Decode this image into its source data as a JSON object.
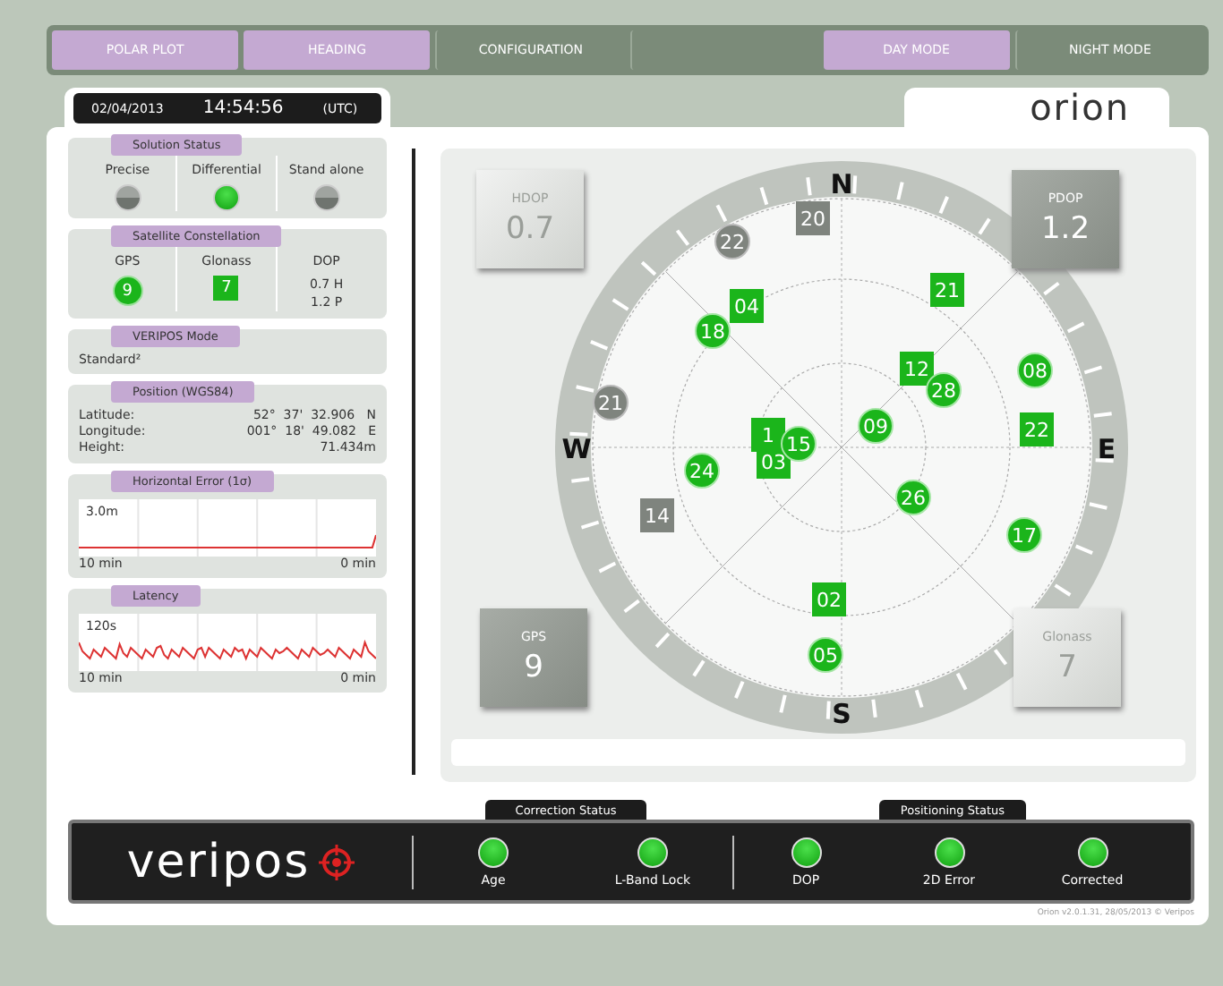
{
  "nav_tabs": [
    {
      "label": "POLAR PLOT",
      "selected": true
    },
    {
      "label": "HEADING",
      "selected": true
    },
    {
      "label": "CONFIGURATION",
      "selected": false
    },
    {
      "selected": false
    },
    {
      "label": "DAY MODE",
      "selected": true
    },
    {
      "label": "NIGHT MODE",
      "selected": false
    }
  ],
  "clock": {
    "date": "02/04/2013",
    "time": "14:54:56",
    "zone": "(UTC)"
  },
  "logo": "orion",
  "solution_status": {
    "title": "Solution Status",
    "items": [
      {
        "label": "Precise",
        "on": false
      },
      {
        "label": "Differential",
        "on": true
      },
      {
        "label": "Stand alone",
        "on": false
      }
    ]
  },
  "satellite_constellation": {
    "title": "Satellite Constellation",
    "gps": {
      "label": "GPS",
      "count": "9"
    },
    "glonass": {
      "label": "Glonass",
      "count": "7"
    },
    "dop": {
      "label": "DOP",
      "lines": [
        "0.7 H",
        "1.2 P"
      ]
    }
  },
  "veripos_mode": {
    "title": "VERIPOS Mode",
    "value": "Standard²"
  },
  "position": {
    "title": "Position  (WGS84)",
    "rows": [
      {
        "label": "Latitude:",
        "value": "52°  37'  32.906   N"
      },
      {
        "label": "Longitude:",
        "value": "001°  18'  49.082   E"
      },
      {
        "label": "Height:",
        "value": "71.434m"
      }
    ]
  },
  "horizontal_error": {
    "title": "Horizontal Error (1σ)",
    "scale": "3.0m",
    "left": "10 min",
    "right": "0 min"
  },
  "latency": {
    "title": "Latency",
    "scale": "120s",
    "left": "10 min",
    "right": "0 min"
  },
  "polar_plot": {
    "compass": [
      "N",
      "E",
      "S",
      "W"
    ],
    "corners": [
      {
        "label": "HDOP",
        "value": "0.7"
      },
      {
        "label": "PDOP",
        "value": "1.2"
      },
      {
        "label": "GPS",
        "value": "9"
      },
      {
        "label": "Glonass",
        "value": "7"
      }
    ],
    "satellites": [
      {
        "id": "22",
        "kind": "gps",
        "used": false
      },
      {
        "id": "20",
        "kind": "glonass",
        "used": false
      },
      {
        "id": "18",
        "kind": "gps",
        "used": true
      },
      {
        "id": "04",
        "kind": "glonass",
        "used": true
      },
      {
        "id": "21",
        "kind": "glonass",
        "used": true
      },
      {
        "id": "21",
        "kind": "gps",
        "used": false
      },
      {
        "id": "12",
        "kind": "glonass",
        "used": true
      },
      {
        "id": "28",
        "kind": "gps",
        "used": true
      },
      {
        "id": "08",
        "kind": "gps",
        "used": true
      },
      {
        "id": "24",
        "kind": "gps",
        "used": true
      },
      {
        "id": "1",
        "kind": "glonass",
        "used": true
      },
      {
        "id": "03",
        "kind": "glonass",
        "used": true
      },
      {
        "id": "15",
        "kind": "gps",
        "used": true
      },
      {
        "id": "09",
        "kind": "gps",
        "used": true
      },
      {
        "id": "22",
        "kind": "glonass",
        "used": true
      },
      {
        "id": "14",
        "kind": "glonass",
        "used": false
      },
      {
        "id": "26",
        "kind": "gps",
        "used": true
      },
      {
        "id": "17",
        "kind": "gps",
        "used": true
      },
      {
        "id": "02",
        "kind": "glonass",
        "used": true
      },
      {
        "id": "05",
        "kind": "gps",
        "used": true
      }
    ]
  },
  "brand": "veripos",
  "correction_status": {
    "title": "Correction Status",
    "items": [
      {
        "label": "Age",
        "on": true
      },
      {
        "label": "L-Band Lock",
        "on": true
      }
    ]
  },
  "positioning_status": {
    "title": "Positioning Status",
    "items": [
      {
        "label": "DOP",
        "on": true
      },
      {
        "label": "2D Error",
        "on": true
      },
      {
        "label": "Corrected",
        "on": true
      }
    ]
  },
  "version": "Orion v2.0.1.31, 28/05/2013 © Veripos"
}
